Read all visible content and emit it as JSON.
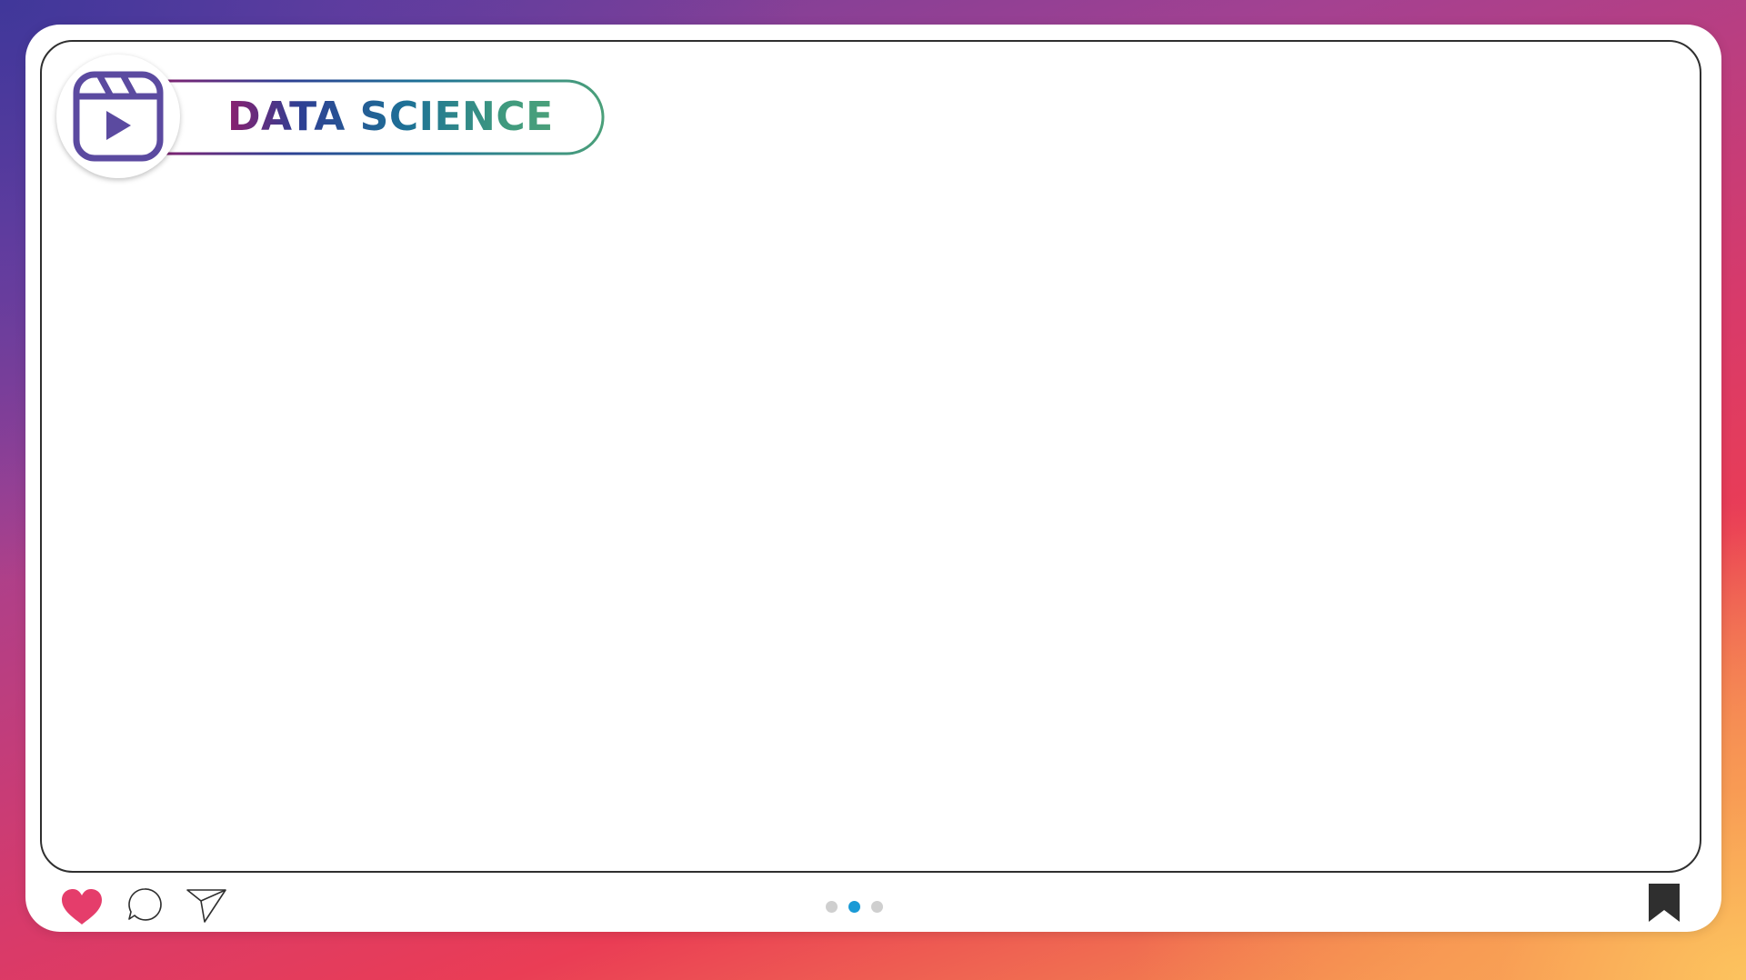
{
  "header": {
    "title": "DATA SCIENCE",
    "badge_icon": "reel-icon"
  },
  "actions": {
    "like_icon": "heart-icon",
    "comment_icon": "comment-icon",
    "share_icon": "send-icon",
    "save_icon": "bookmark-icon"
  },
  "carousel": {
    "count": 3,
    "active_index": 1
  },
  "colors": {
    "heart": "#e53d6b",
    "active_dot": "#1a9ad6",
    "inactive_dot": "#cfcfcf",
    "reel_icon": "#5b4aa0",
    "frame_border": "#2f2f2f"
  }
}
